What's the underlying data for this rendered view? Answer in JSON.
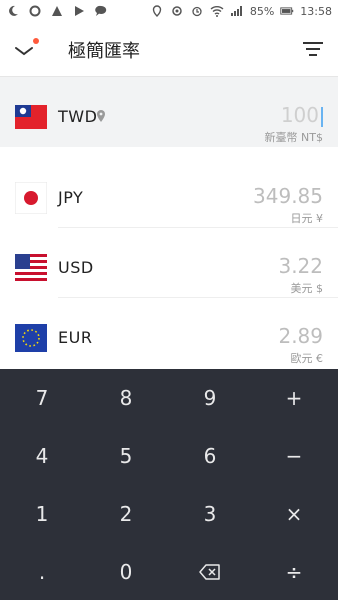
{
  "status_bar": {
    "battery": "85%",
    "time": "13:58"
  },
  "header": {
    "title": "極簡匯率"
  },
  "currencies": [
    {
      "code": "TWD",
      "value": "100",
      "unit": "新臺幣 NT$"
    },
    {
      "code": "JPY",
      "value": "349.85",
      "unit": "日元 ¥"
    },
    {
      "code": "USD",
      "value": "3.22",
      "unit": "美元 $"
    },
    {
      "code": "EUR",
      "value": "2.89",
      "unit": "歐元 €"
    }
  ],
  "keypad": {
    "keys": [
      "7",
      "8",
      "9",
      "+",
      "4",
      "5",
      "6",
      "−",
      "1",
      "2",
      "3",
      "×",
      ".",
      "0",
      "⌫",
      "÷"
    ]
  },
  "colors": {
    "keypad_bg": "#2d3039",
    "caret": "#69b3f1",
    "badge": "#ff5a3c"
  }
}
